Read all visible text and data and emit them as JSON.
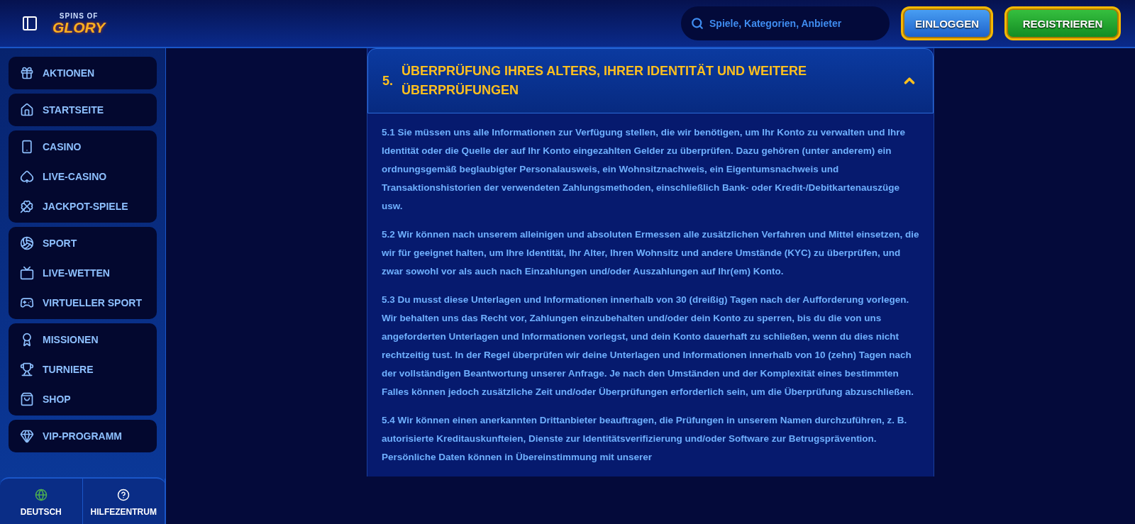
{
  "header": {
    "logo": {
      "line_1": "SPINS OF",
      "line_2": "GLORY"
    },
    "search": {
      "placeholder": "Spiele, Kategorien, Anbieter"
    },
    "buttons": [
      {
        "label": "EINLOGGEN",
        "kind": "login"
      },
      {
        "label": "REGISTRIEREN",
        "kind": "register"
      }
    ]
  },
  "sidebar": {
    "groups": [
      {
        "items": [
          {
            "label": "AKTIONEN"
          }
        ]
      },
      {
        "items": [
          {
            "label": "STARTSEITE"
          }
        ]
      },
      {
        "items": [
          {
            "label": "CASINO"
          },
          {
            "label": "LIVE-CASINO"
          },
          {
            "label": "JACKPOT-SPIELE"
          }
        ]
      },
      {
        "items": [
          {
            "label": "SPORT"
          },
          {
            "label": "LIVE-WETTEN"
          },
          {
            "label": "VIRTUELLER SPORT"
          }
        ]
      },
      {
        "items": [
          {
            "label": "MISSIONEN"
          },
          {
            "label": "TURNIERE"
          },
          {
            "label": "SHOP"
          }
        ]
      },
      {
        "items": [
          {
            "label": "VIP-PROGRAMM"
          }
        ]
      }
    ],
    "footer": [
      {
        "label": "DEUTSCH",
        "kind": "language"
      },
      {
        "label": "HILFEZENTRUM",
        "kind": "help"
      }
    ]
  },
  "section": {
    "number": "5.",
    "title": "ÜBERPRÜFUNG IHRES ALTERS, IHRER IDENTITÄT UND WEITERE ÜBERPRÜFUNGEN",
    "expanded": true,
    "paragraphs": [
      "5.1 Sie müssen uns alle Informationen zur Verfügung stellen, die wir benötigen, um Ihr Konto zu verwalten und Ihre Identität oder die Quelle der auf Ihr Konto eingezahlten Gelder zu überprüfen. Dazu gehören (unter anderem) ein ordnungsgemäß beglaubigter Personalausweis, ein Wohnsitznachweis, ein Eigentumsnachweis und Transaktionshistorien der verwendeten Zahlungsmethoden, einschließlich Bank- oder Kredit-/Debitkartenauszüge usw.",
      "5.2 Wir können nach unserem alleinigen und absoluten Ermessen alle zusätzlichen Verfahren und Mittel einsetzen, die wir für geeignet halten, um Ihre Identität, Ihr Alter, Ihren Wohnsitz und andere Umstände (KYC) zu überprüfen, und zwar sowohl vor als auch nach Einzahlungen und/oder Auszahlungen auf Ihr(em) Konto.",
      "5.3 Du musst diese Unterlagen und Informationen innerhalb von 30 (dreißig) Tagen nach der Aufforderung vorlegen. Wir behalten uns das Recht vor, Zahlungen einzubehalten und/oder dein Konto zu sperren, bis du die von uns angeforderten Unterlagen und Informationen vorlegst, und dein Konto dauerhaft zu schließen, wenn du dies nicht rechtzeitig tust. In der Regel überprüfen wir deine Unterlagen und Informationen innerhalb von 10 (zehn) Tagen nach der vollständigen Beantwortung unserer Anfrage. Je nach den Umständen und der Komplexität eines bestimmten Falles können jedoch zusätzliche Zeit und/oder Überprüfungen erforderlich sein, um die Überprüfung abzuschließen.",
      "5.4 Wir können einen anerkannten Drittanbieter beauftragen, die Prüfungen in unserem Namen durchzuführen, z. B. autorisierte Kreditauskunfteien, Dienste zur Identitätsverifizierung und/oder Software zur Betrugsprävention. Persönliche Daten können in Übereinstimmung mit unserer"
    ]
  }
}
